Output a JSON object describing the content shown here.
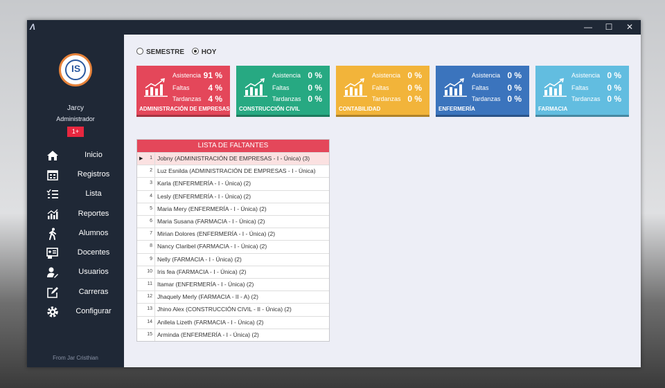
{
  "window": {
    "controls": {
      "minimize": "—",
      "maximize": "☐",
      "close": "✕"
    }
  },
  "sidebar": {
    "user_name": "Jarcy",
    "user_role": "Administrador",
    "notification_badge": "1+",
    "items": [
      {
        "label": "Inicio",
        "icon": "home-icon"
      },
      {
        "label": "Registros",
        "icon": "calendar-icon"
      },
      {
        "label": "Lista",
        "icon": "checklist-icon"
      },
      {
        "label": "Reportes",
        "icon": "report-chart-icon"
      },
      {
        "label": "Alumnos",
        "icon": "walking-person-icon"
      },
      {
        "label": "Docentes",
        "icon": "teacher-board-icon"
      },
      {
        "label": "Usuarios",
        "icon": "user-edit-icon"
      },
      {
        "label": "Carreras",
        "icon": "edit-square-icon"
      },
      {
        "label": "Configurar",
        "icon": "gear-icon"
      }
    ],
    "footer": "From Jar Cristhian"
  },
  "filter": {
    "options": [
      {
        "label": "SEMESTRE",
        "checked": false
      },
      {
        "label": "HOY",
        "checked": true
      }
    ]
  },
  "stat_labels": {
    "asistencia": "Asistencia",
    "faltas": "Faltas",
    "tardanzas": "Tardanzas"
  },
  "cards": [
    {
      "name": "ADMINISTRACIÓN DE EMPRESAS",
      "asistencia": "91 %",
      "faltas": "4 %",
      "tardanzas": "4 %",
      "color": "#e4475a"
    },
    {
      "name": "CONSTRUCCIÓN CIVIL",
      "asistencia": "0 %",
      "faltas": "0 %",
      "tardanzas": "0 %",
      "color": "#27a982"
    },
    {
      "name": "CONTABILIDAD",
      "asistencia": "0 %",
      "faltas": "0 %",
      "tardanzas": "0 %",
      "color": "#f2b43a"
    },
    {
      "name": "ENFERMERÍA",
      "asistencia": "0 %",
      "faltas": "0 %",
      "tardanzas": "0 %",
      "color": "#3b74bd"
    },
    {
      "name": "FARMACIA",
      "asistencia": "0 %",
      "faltas": "0 %",
      "tardanzas": "0 %",
      "color": "#62bde0"
    }
  ],
  "missing_list": {
    "title": "LISTA DE FALTANTES",
    "rows": [
      {
        "num": "1",
        "text": "Jobny (ADMINISTRACIÓN DE EMPRESAS - I - Única) (3)",
        "selected": true
      },
      {
        "num": "2",
        "text": "Luz Esnilda (ADMINISTRACIÓN DE EMPRESAS - I - Única)"
      },
      {
        "num": "3",
        "text": "Karla (ENFERMERÍA - I - Única) (2)"
      },
      {
        "num": "4",
        "text": "Lesly (ENFERMERÍA - I - Única) (2)"
      },
      {
        "num": "5",
        "text": "Maria Mery (ENFERMERÍA - I - Única) (2)"
      },
      {
        "num": "6",
        "text": "Maria Susana (FARMACIA - I - Única) (2)"
      },
      {
        "num": "7",
        "text": "Mirian Dolores (ENFERMERÍA - I - Única) (2)"
      },
      {
        "num": "8",
        "text": "Nancy Claribel (FARMACIA - I - Única) (2)"
      },
      {
        "num": "9",
        "text": "Nelly (FARMACIA - I - Única) (2)"
      },
      {
        "num": "10",
        "text": "Iris fea (FARMACIA - I - Única) (2)"
      },
      {
        "num": "11",
        "text": "Itamar (ENFERMERÍA - I - Única) (2)"
      },
      {
        "num": "12",
        "text": "Jhaquely Merly (FARMACIA - II - A) (2)"
      },
      {
        "num": "13",
        "text": "Jhino Alex (CONSTRUCCIÓN CIVIL - II - Única) (2)"
      },
      {
        "num": "14",
        "text": "Anllela Lizeth (FARMACIA - I - Única) (2)"
      },
      {
        "num": "15",
        "text": "Arminda (ENFERMERÍA - I - Única) (2)"
      }
    ]
  }
}
